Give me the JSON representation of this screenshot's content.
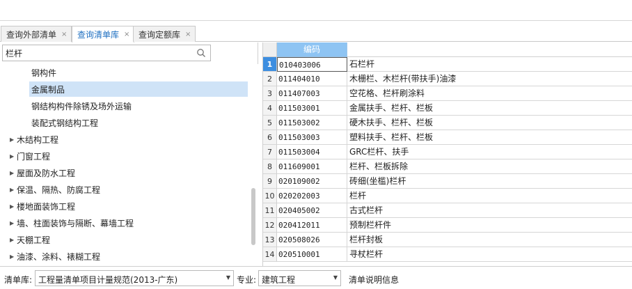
{
  "tabs": [
    {
      "label": "查询外部清单",
      "close": "×"
    },
    {
      "label": "查询清单库",
      "close": "×"
    },
    {
      "label": "查询定额库",
      "close": "×"
    }
  ],
  "search": {
    "value": "栏杆"
  },
  "tree": {
    "children": [
      {
        "label": "钢构件"
      },
      {
        "label": "金属制品"
      },
      {
        "label": "钢结构构件除锈及场外运输"
      },
      {
        "label": "装配式钢结构工程"
      }
    ],
    "parents": [
      {
        "label": "木结构工程"
      },
      {
        "label": "门窗工程"
      },
      {
        "label": "屋面及防水工程"
      },
      {
        "label": "保温、隔热、防腐工程"
      },
      {
        "label": "楼地面装饰工程"
      },
      {
        "label": "墙、柱面装饰与隔断、幕墙工程"
      },
      {
        "label": "天棚工程"
      },
      {
        "label": "油漆、涂料、裱糊工程"
      }
    ]
  },
  "grid": {
    "header": "编码",
    "rows": [
      {
        "num": "1",
        "code": "010403006",
        "name": "石栏杆"
      },
      {
        "num": "2",
        "code": "011404010",
        "name": "木栅栏、木栏杆(带扶手)油漆"
      },
      {
        "num": "3",
        "code": "011407003",
        "name": "空花格、栏杆刷涂料"
      },
      {
        "num": "4",
        "code": "011503001",
        "name": "金属扶手、栏杆、栏板"
      },
      {
        "num": "5",
        "code": "011503002",
        "name": "硬木扶手、栏杆、栏板"
      },
      {
        "num": "6",
        "code": "011503003",
        "name": "塑料扶手、栏杆、栏板"
      },
      {
        "num": "7",
        "code": "011503004",
        "name": "GRC栏杆、扶手"
      },
      {
        "num": "8",
        "code": "011609001",
        "name": "栏杆、栏板拆除"
      },
      {
        "num": "9",
        "code": "020109002",
        "name": "砖细(坐槛)栏杆"
      },
      {
        "num": "10",
        "code": "020202003",
        "name": "栏杆"
      },
      {
        "num": "11",
        "code": "020405002",
        "name": "古式栏杆"
      },
      {
        "num": "12",
        "code": "020412011",
        "name": "预制栏杆件"
      },
      {
        "num": "13",
        "code": "020508026",
        "name": "栏杆封板"
      },
      {
        "num": "14",
        "code": "020510001",
        "name": "寻杖栏杆"
      }
    ]
  },
  "bottom": {
    "list_label": "清单库:",
    "list_value": "工程量清单项目计量规范(2013-广东)",
    "major_label": "专业:",
    "major_value": "建筑工程",
    "info_label": "清单说明信息"
  },
  "colors": {
    "accent": "#1e6fc1",
    "header_bg": "#8ec4f3",
    "selected_bg": "#cfe3f7"
  }
}
